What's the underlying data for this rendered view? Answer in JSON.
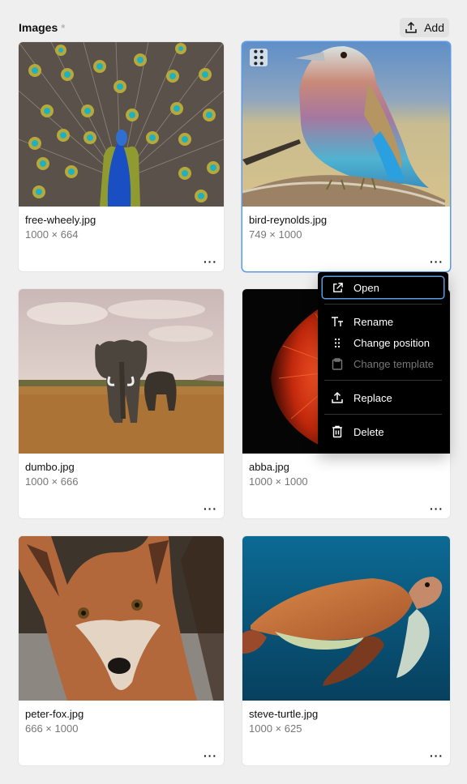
{
  "header": {
    "title": "Images",
    "required_marker": "*",
    "add_label": "Add",
    "add_icon": "upload-icon"
  },
  "images": [
    {
      "name": "free-wheely.jpg",
      "dims": "1000 × 664",
      "subject": "peacock",
      "more": "···",
      "selected": false
    },
    {
      "name": "bird-reynolds.jpg",
      "dims": "749 × 1000",
      "subject": "bird",
      "more": "···",
      "selected": true
    },
    {
      "name": "dumbo.jpg",
      "dims": "1000 × 666",
      "subject": "elephant",
      "more": "···",
      "selected": false
    },
    {
      "name": "abba.jpg",
      "dims": "1000 × 1000",
      "subject": "betta-fish",
      "more": "···",
      "selected": false
    },
    {
      "name": "peter-fox.jpg",
      "dims": "666 × 1000",
      "subject": "fox",
      "more": "···",
      "selected": false
    },
    {
      "name": "steve-turtle.jpg",
      "dims": "1000 × 625",
      "subject": "sea-turtle",
      "more": "···",
      "selected": false
    }
  ],
  "context_menu": {
    "items": [
      {
        "label": "Open",
        "icon": "external-link-icon",
        "focused": true,
        "disabled": false
      },
      {
        "label": "Rename",
        "icon": "text-icon",
        "disabled": false
      },
      {
        "label": "Change position",
        "icon": "drag-handle-icon",
        "disabled": false
      },
      {
        "label": "Change template",
        "icon": "clipboard-icon",
        "disabled": true
      },
      {
        "label": "Replace",
        "icon": "upload-icon",
        "disabled": false
      },
      {
        "label": "Delete",
        "icon": "trash-icon",
        "disabled": false
      }
    ]
  },
  "colors": {
    "accent": "#5b9be6",
    "background": "#efefef",
    "menu_bg": "#000000",
    "disabled_text": "#777777"
  }
}
